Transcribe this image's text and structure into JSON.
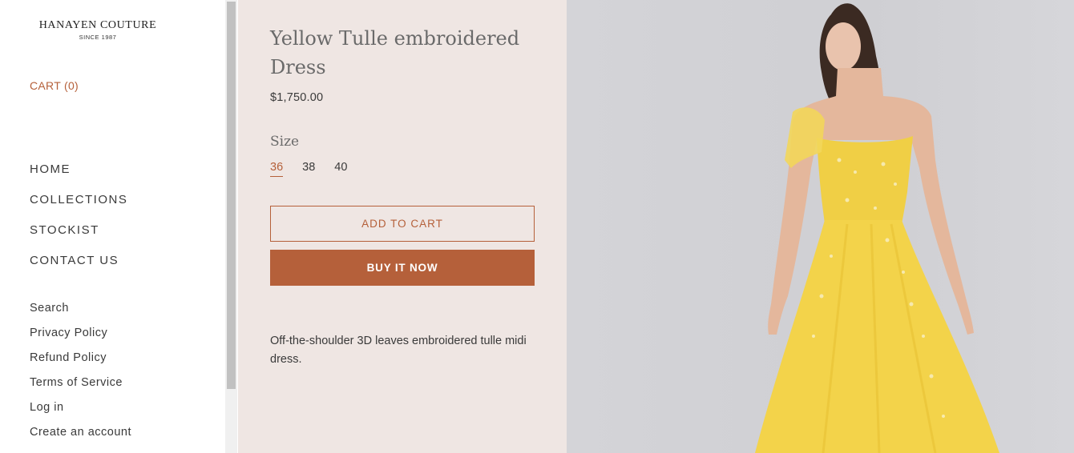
{
  "brand": {
    "name": "HANAYEN COUTURE",
    "since": "SINCE 1987"
  },
  "cart": {
    "label": "CART (0)"
  },
  "main_nav": [
    "HOME",
    "COLLECTIONS",
    "STOCKIST",
    "CONTACT US"
  ],
  "secondary_nav": [
    "Search",
    "Privacy Policy",
    "Refund Policy",
    "Terms of Service",
    "Log in",
    "Create an account"
  ],
  "product": {
    "title": "Yellow Tulle embroidered Dress",
    "price": "$1,750.00",
    "size_label": "Size",
    "sizes": [
      "36",
      "38",
      "40"
    ],
    "selected_size": "36",
    "add_to_cart": "ADD TO CART",
    "buy_now": "BUY IT NOW",
    "description": "Off-the-shoulder 3D leaves embroidered tulle midi dress."
  },
  "colors": {
    "accent": "#b5603a",
    "panel_bg": "#efe6e3",
    "dress": "#f3d34a"
  }
}
